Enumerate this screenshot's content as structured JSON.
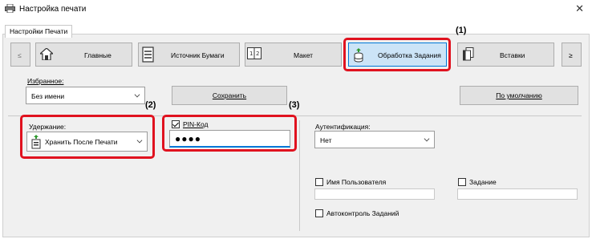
{
  "window": {
    "title": "Настройка печати",
    "close_glyph": "✕"
  },
  "tabs": [
    {
      "label": "Настройки Печати"
    }
  ],
  "nav": {
    "prev": "≤",
    "next": "≥",
    "buttons": [
      {
        "label": "Главные",
        "icon": "home-icon"
      },
      {
        "label": "Источник Бумаги",
        "icon": "paper-tray-icon"
      },
      {
        "label": "Макет",
        "icon": "layout-icon"
      },
      {
        "label": "Обработка Задания",
        "icon": "job-handling-icon"
      },
      {
        "label": "Вставки",
        "icon": "inserts-icon"
      }
    ]
  },
  "favorites": {
    "label": "Избранное:",
    "value": "Без имени"
  },
  "buttons": {
    "save": "Сохранить",
    "default": "По умолчанию"
  },
  "retention": {
    "label": "Удержание:",
    "value": "Хранить После Печати"
  },
  "pin": {
    "label": "PIN-Код",
    "checked": true,
    "value": "●●●●"
  },
  "auth": {
    "label": "Аутентификация:",
    "value": "Нет"
  },
  "options": {
    "username": "Имя Пользователя",
    "job": "Задание",
    "autocontrol": "Автоконтроль Заданий"
  },
  "callouts": {
    "one": "(1)",
    "two": "(2)",
    "three": "(3)"
  },
  "colors": {
    "highlight": "#e0121f",
    "active_tab": "#cce4f7",
    "accent": "#0078d7"
  }
}
